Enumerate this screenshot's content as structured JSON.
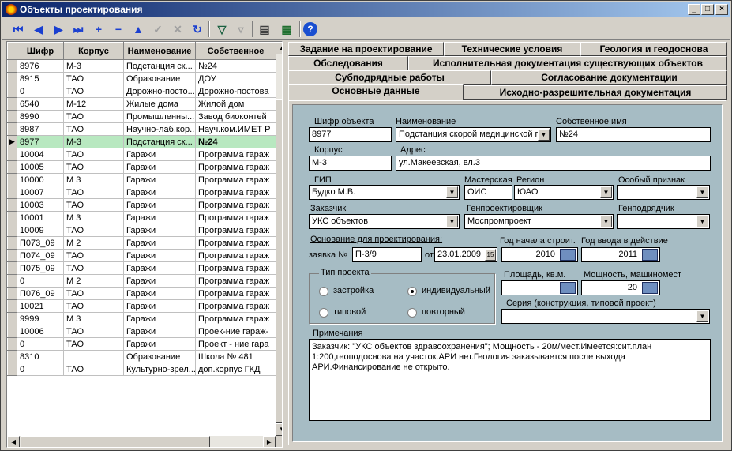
{
  "window": {
    "title": "Объекты проектирования"
  },
  "toolbar": {
    "icons": [
      "first-record",
      "prior-record",
      "next-record",
      "last-record",
      "insert-record",
      "delete-record",
      "edit-record",
      "post-record",
      "cancel-edit",
      "refresh-data",
      "filter",
      "clear-filter",
      "properties",
      "export-excel",
      "help"
    ]
  },
  "grid": {
    "columns": [
      "Шифр",
      "Корпус",
      "Наименование",
      "Собственное"
    ],
    "rows": [
      [
        "8976",
        "М-3",
        "Подстанция ск...",
        "№24"
      ],
      [
        "8915",
        "ТАО",
        "Образование",
        "ДОУ"
      ],
      [
        "0",
        "ТАО",
        "Дорожно-посто...",
        "Дорожно-постова"
      ],
      [
        "6540",
        "М-12",
        "Жилые дома",
        "Жилой дом"
      ],
      [
        "8990",
        "ТАО",
        "Промышленны...",
        "Завод биоконтей"
      ],
      [
        "8987",
        "ТАО",
        "Научно-лаб.кор...",
        "Науч.ком.ИМЕТ Р"
      ],
      [
        "8977",
        "М-3",
        "Подстанция ск...",
        "№24"
      ],
      [
        "10004",
        "ТАО",
        "Гаражи",
        "Программа гараж"
      ],
      [
        "10005",
        "ТАО",
        "Гаражи",
        "Программа гараж"
      ],
      [
        "10000",
        "М 3",
        "Гаражи",
        "Программа гараж"
      ],
      [
        "10007",
        "ТАО",
        "Гаражи",
        "Программа гараж"
      ],
      [
        "10003",
        "ТАО",
        "Гаражи",
        "Программа гараж"
      ],
      [
        "10001",
        "М 3",
        "Гаражи",
        "Программа гараж"
      ],
      [
        "10009",
        "ТАО",
        "Гаражи",
        "Программа гараж"
      ],
      [
        "П073_09",
        "М 2",
        "Гаражи",
        "Программа гараж"
      ],
      [
        "П074_09",
        "ТАО",
        "Гаражи",
        "Программа гараж"
      ],
      [
        "П075_09",
        "ТАО",
        "Гаражи",
        "Программа гараж"
      ],
      [
        "0",
        "М 2",
        "Гаражи",
        "Программа гараж"
      ],
      [
        "П076_09",
        "ТАО",
        "Гаражи",
        "Программа гараж"
      ],
      [
        "10021",
        "ТАО",
        "Гаражи",
        "Программа гараж"
      ],
      [
        "9999",
        "М 3",
        "Гаражи",
        "Программа гараж"
      ],
      [
        "10006",
        "ТАО",
        "Гаражи",
        "Проек-ние гараж-"
      ],
      [
        "0",
        "ТАО",
        "Гаражи",
        "Проект - ние гара"
      ],
      [
        "8310",
        "",
        "Образование",
        "Школа № 481"
      ],
      [
        "0",
        "ТАО",
        "Культурно-зрел...",
        "доп.корпус ГКД"
      ]
    ],
    "selected_index": 6
  },
  "tabs": {
    "row1": [
      "Задание на проектирование",
      "Технические условия",
      "Геология и геодоснова"
    ],
    "row2": [
      "Обследования",
      "Исполнительная документация существующих объектов"
    ],
    "row3": [
      "Субподрядные работы",
      "Согласование документации"
    ],
    "row4": [
      "Основные данные",
      "Исходно-разрешительная документация"
    ],
    "active": "Основные данные"
  },
  "form": {
    "shifr_label": "Шифр объекта",
    "shifr": "8977",
    "name_label": "Наименование",
    "name": "Подстанция скорой медицинской п",
    "own_name_label": "Собственное имя",
    "own_name": "№24",
    "korpus_label": "Корпус",
    "korpus": "М-3",
    "address_label": "Адрес",
    "address": "ул.Макеевская, вл.3",
    "gip_label": "ГИП",
    "gip": "Будко М.В.",
    "workshop_label": "Мастерская",
    "workshop": "ОИС",
    "region_label": "Регион",
    "region": "ЮАО",
    "special_label": "Особый признак",
    "special": "",
    "customer_label": "Заказчик",
    "customer": "УКС объектов",
    "gen_designer_label": "Генпроектировщик",
    "gen_designer": "Моспромпроект",
    "gen_contractor_label": "Генподрядчик",
    "gen_contractor": "",
    "basis_label": "Основание для проектирования:",
    "request_label": "заявка №",
    "request": "П-3/9",
    "from_label": "от",
    "from_date": "23.01.2009",
    "start_year_label": "Год начала строит.",
    "start_year": "2010",
    "commission_year_label": "Год ввода в действие",
    "commission_year": "2011",
    "project_type_label": "Тип проекта",
    "radio_options": [
      "застройка",
      "индивидуальный",
      "типовой",
      "повторный"
    ],
    "radio_selected": "индивидуальный",
    "area_label": "Площадь, кв.м.",
    "area": "",
    "capacity_label": "Мощность, машиномест",
    "capacity": "20",
    "series_label": "Серия (конструкция, типовой проект)",
    "series": "",
    "notes_label": "Примечания",
    "notes": "Заказчик: \"УКС объектов здравоохранения\"; Мощность - 20м/мест.Имеется:сит.план\n1:200,геоподоснова на участок.АРИ нет.Геология заказывается после выхода\nАРИ.Финансирование не открыто."
  }
}
